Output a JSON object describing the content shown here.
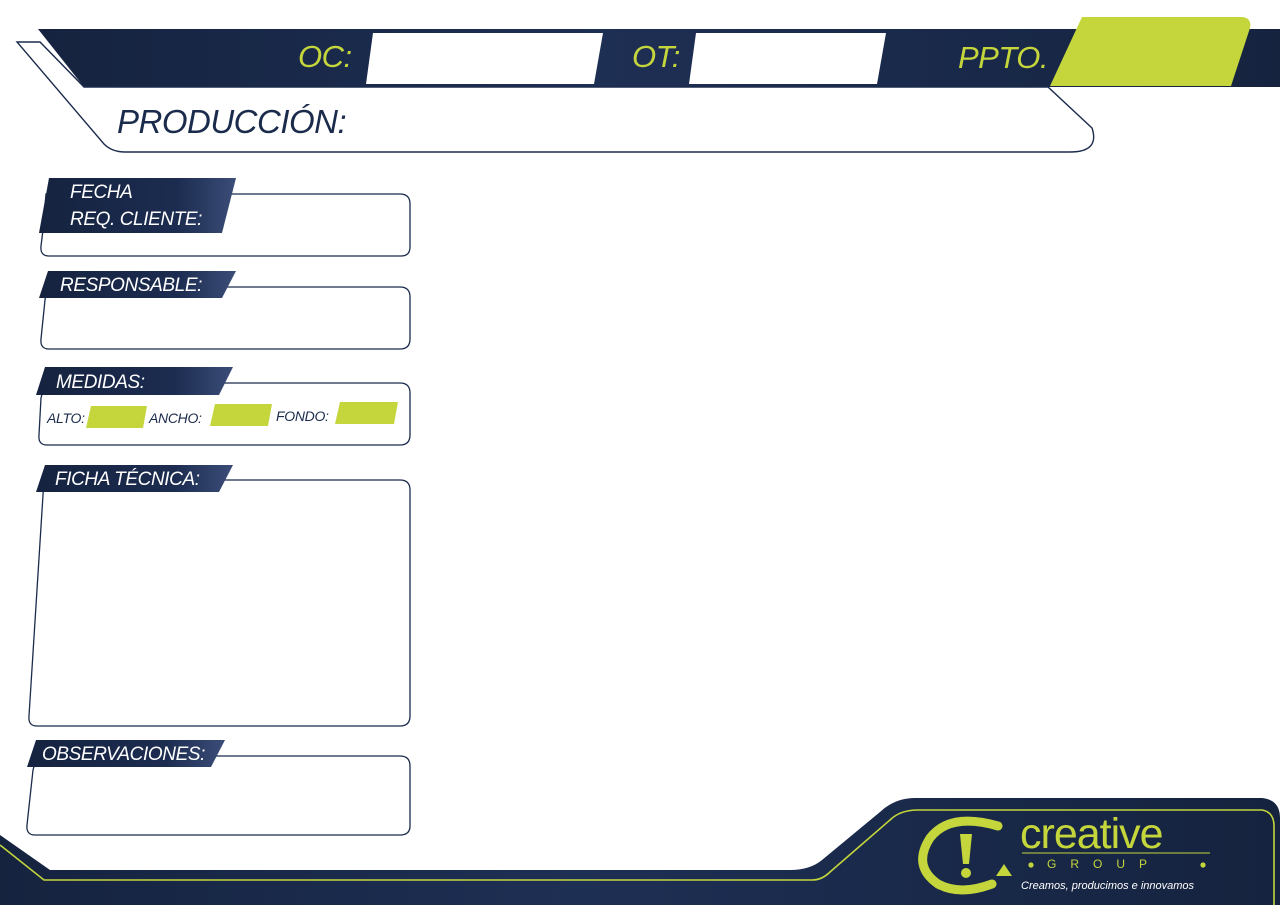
{
  "header": {
    "oc_label": "OC:",
    "ot_label": "OT:",
    "ppto_label": "PPTO.",
    "oc_value": "",
    "ot_value": "",
    "ppto_value": ""
  },
  "production": {
    "label": "PRODUCCIÓN:",
    "value": ""
  },
  "sections": {
    "fecha": {
      "label_line1": "FECHA",
      "label_line2": "REQ. CLIENTE:",
      "value": ""
    },
    "responsable": {
      "label": "RESPONSABLE:",
      "value": ""
    },
    "medidas": {
      "label": "MEDIDAS:",
      "alto_label": "ALTO:",
      "ancho_label": "ANCHO:",
      "fondo_label": "FONDO:",
      "alto_value": "",
      "ancho_value": "",
      "fondo_value": ""
    },
    "ficha": {
      "label": "FICHA TÉCNICA:",
      "value": ""
    },
    "observaciones": {
      "label": "OBSERVACIONES:",
      "value": ""
    }
  },
  "brand": {
    "wordmark": "creative",
    "subline": "GROUP",
    "slogan": "Creamos, producimos e innovamos",
    "logo_icon": "exclamation-swirl-icon"
  },
  "colors": {
    "navy": "#1b2b4c",
    "lime": "#c4d63c",
    "white": "#ffffff"
  }
}
